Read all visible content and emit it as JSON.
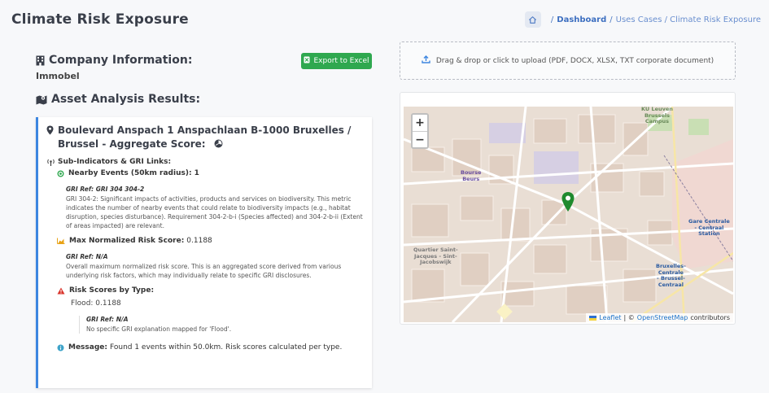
{
  "header": {
    "title": "Climate Risk Exposure",
    "breadcrumb": {
      "sep1": "/",
      "dashboard": "Dashboard",
      "sep2": "/",
      "current": "Uses Cases / Climate Risk Exposure"
    }
  },
  "company": {
    "section_title": "Company Information:",
    "name": "Immobel",
    "export_label": "Export to Excel"
  },
  "upload": {
    "label": "Drag & drop or click to upload (PDF, DOCX, XLSX, TXT corporate document)"
  },
  "results": {
    "section_title": "Asset Analysis Results:",
    "asset": {
      "title": "Boulevard Anspach 1 Anspachlaan B-1000 Bruxelles / Brussel - Aggregate Score:",
      "subindicators_label": "Sub-Indicators & GRI Links:",
      "nearby_events_label": "Nearby Events (50km radius):",
      "nearby_events_value": "1",
      "nearby_gri_ref": "GRI Ref: GRI 304 304-2",
      "nearby_gri_text": "GRI 304-2: Significant impacts of activities, products and services on biodiversity. This metric indicates the number of nearby events that could relate to biodiversity impacts (e.g., habitat disruption, species disturbance). Requirement 304-2-b-i (Species affected) and 304-2-b-ii (Extent of areas impacted) are relevant.",
      "max_score_label": "Max Normalized Risk Score:",
      "max_score_value": "0.1188",
      "max_gri_ref": "GRI Ref: N/A",
      "max_gri_text": "Overall maximum normalized risk score. This is an aggregated score derived from various underlying risk factors, which may individually relate to specific GRI disclosures.",
      "risk_by_type_label": "Risk Scores by Type:",
      "flood_line": "Flood: 0.1188",
      "flood_gri_ref": "GRI Ref: N/A",
      "flood_gri_text": "No specific GRI explanation mapped for 'Flood'.",
      "message_label": "Message:",
      "message_text": "Found 1 events within 50.0km. Risk scores calculated per type."
    }
  },
  "map": {
    "zoom_in": "+",
    "zoom_out": "−",
    "attribution_leaflet": "Leaflet",
    "attribution_sep": "| ©",
    "attribution_osm": "OpenStreetMap",
    "attribution_contrib": "contributors",
    "labels": {
      "bourse": "Bourse\nBeurs",
      "quartier": "Quartier Saint-\nJacques - Sint-\nJacobswijk",
      "gare": "Gare Centrale\n- Centraal\nStation",
      "bruxelles_centrale": "Bruxelles-\nCentrale\n- Brussel-\nCentraal",
      "ku": "KU Leuven\nBrussels\nCampus"
    },
    "marker_color": "#1f8a2e"
  },
  "colors": {
    "accent": "#3d86e0",
    "export": "#2fa84f"
  }
}
